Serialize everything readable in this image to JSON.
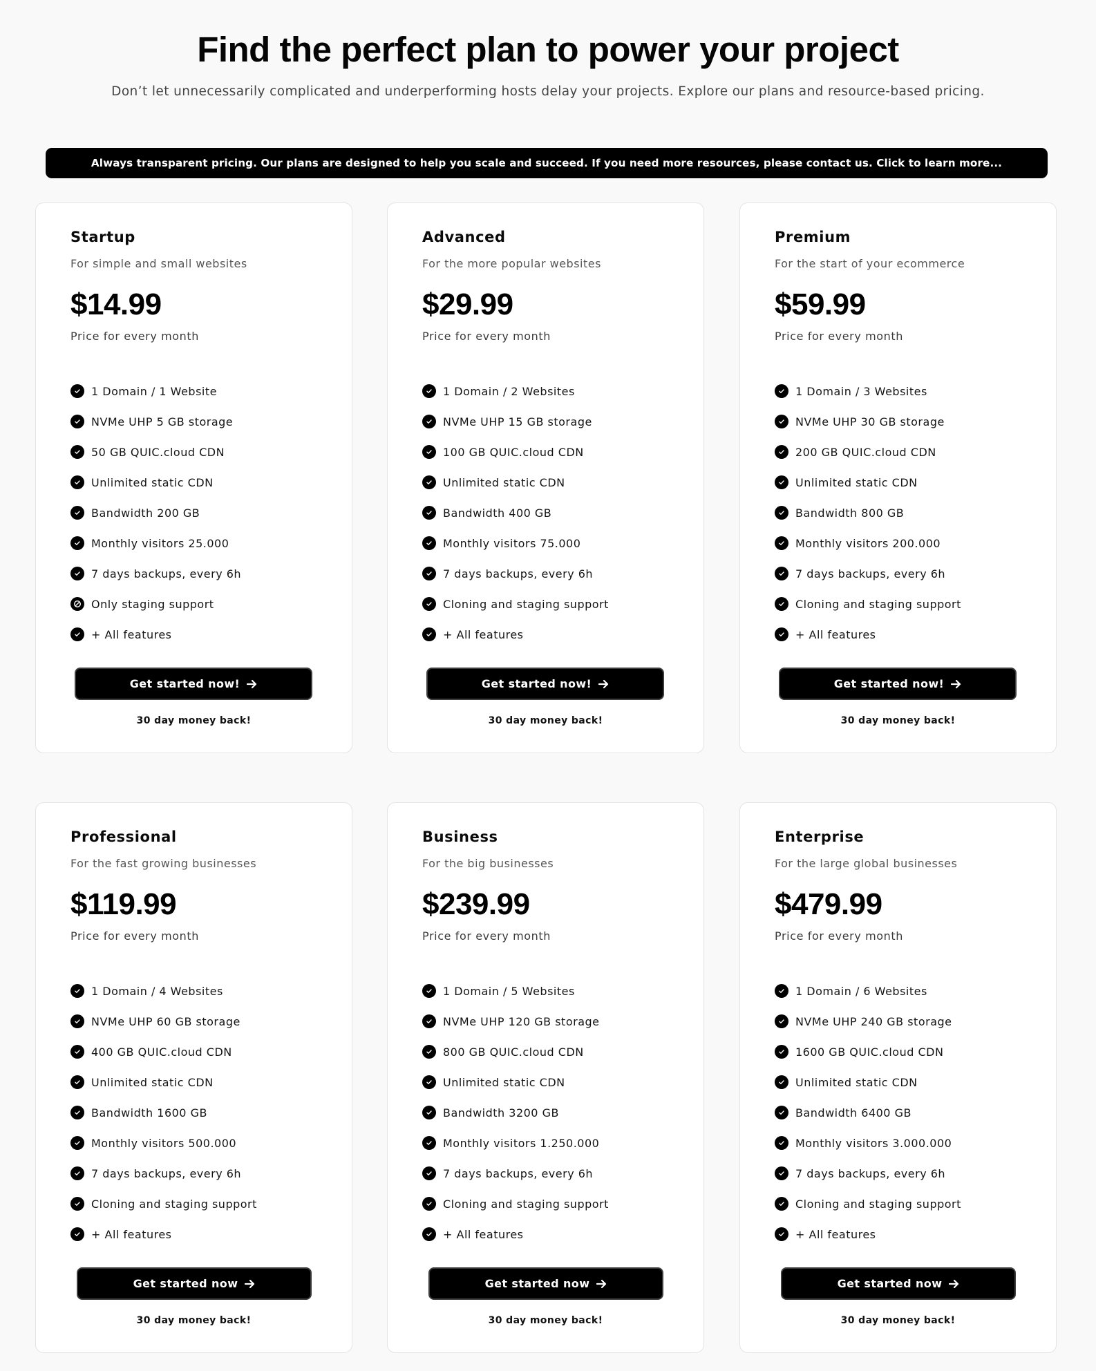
{
  "header": {
    "title": "Find the perfect plan to power your project",
    "subtitle": "Don’t let unnecessarily complicated and underperforming hosts delay your projects. Explore our plans and resource-based pricing."
  },
  "banner": {
    "text": "Always transparent pricing. Our plans are designed to help you scale and succeed. If you need more resources, please contact us. Click to learn more..."
  },
  "colors": {
    "background": "#f9f9f9",
    "card": "#ffffff",
    "accent": "#000000",
    "card_border": "#e4e4e4"
  },
  "plans": [
    {
      "name": "Startup",
      "description": "For simple and small websites",
      "price": "$14.99",
      "price_caption": "Price for every month",
      "features": [
        {
          "text": "1 Domain / 1 Website",
          "icon": "check-circle-icon"
        },
        {
          "text": "NVMe UHP 5 GB storage",
          "icon": "check-circle-icon"
        },
        {
          "text": "50 GB QUIC.cloud CDN",
          "icon": "check-circle-icon"
        },
        {
          "text": "Unlimited static CDN",
          "icon": "check-circle-icon"
        },
        {
          "text": "Bandwidth 200 GB",
          "icon": "check-circle-icon"
        },
        {
          "text": "Monthly visitors 25.000",
          "icon": "check-circle-icon"
        },
        {
          "text": "7 days backups, every 6h",
          "icon": "check-circle-icon"
        },
        {
          "text": "Only staging support",
          "icon": "ban-circle-icon"
        },
        {
          "text": "+ All features",
          "icon": "check-circle-icon"
        }
      ],
      "cta_label": "Get started now!",
      "cta_icon": "arrow-right-icon",
      "guarantee": "30 day money back!"
    },
    {
      "name": "Advanced",
      "description": "For the more popular websites",
      "price": "$29.99",
      "price_caption": "Price for every month",
      "features": [
        {
          "text": "1 Domain / 2 Websites",
          "icon": "check-circle-icon"
        },
        {
          "text": "NVMe UHP 15 GB storage",
          "icon": "check-circle-icon"
        },
        {
          "text": "100 GB QUIC.cloud CDN",
          "icon": "check-circle-icon"
        },
        {
          "text": "Unlimited static CDN",
          "icon": "check-circle-icon"
        },
        {
          "text": "Bandwidth 400 GB",
          "icon": "check-circle-icon"
        },
        {
          "text": "Monthly visitors 75.000",
          "icon": "check-circle-icon"
        },
        {
          "text": "7 days backups, every 6h",
          "icon": "check-circle-icon"
        },
        {
          "text": "Cloning and staging support",
          "icon": "check-circle-icon"
        },
        {
          "text": "+ All features",
          "icon": "check-circle-icon"
        }
      ],
      "cta_label": "Get started now!",
      "cta_icon": "arrow-right-icon",
      "guarantee": "30 day money back!"
    },
    {
      "name": "Premium",
      "description": "For the start of your ecommerce",
      "price": "$59.99",
      "price_caption": "Price for every month",
      "features": [
        {
          "text": "1 Domain / 3 Websites",
          "icon": "check-circle-icon"
        },
        {
          "text": "NVMe UHP 30 GB storage",
          "icon": "check-circle-icon"
        },
        {
          "text": "200 GB QUIC.cloud CDN",
          "icon": "check-circle-icon"
        },
        {
          "text": "Unlimited static CDN",
          "icon": "check-circle-icon"
        },
        {
          "text": "Bandwidth 800 GB",
          "icon": "check-circle-icon"
        },
        {
          "text": "Monthly visitors 200.000",
          "icon": "check-circle-icon"
        },
        {
          "text": "7 days backups, every 6h",
          "icon": "check-circle-icon"
        },
        {
          "text": "Cloning and staging support",
          "icon": "check-circle-icon"
        },
        {
          "text": "+ All features",
          "icon": "check-circle-icon"
        }
      ],
      "cta_label": "Get started now!",
      "cta_icon": "arrow-right-icon",
      "guarantee": "30 day money back!"
    },
    {
      "name": "Professional",
      "description": "For the fast growing businesses",
      "price": "$119.99",
      "price_caption": "Price for every month",
      "features": [
        {
          "text": "1 Domain / 4 Websites",
          "icon": "check-circle-icon"
        },
        {
          "text": "NVMe UHP 60 GB storage",
          "icon": "check-circle-icon"
        },
        {
          "text": "400 GB QUIC.cloud CDN",
          "icon": "check-circle-icon"
        },
        {
          "text": "Unlimited static CDN",
          "icon": "check-circle-icon"
        },
        {
          "text": "Bandwidth 1600 GB",
          "icon": "check-circle-icon"
        },
        {
          "text": "Monthly visitors 500.000",
          "icon": "check-circle-icon"
        },
        {
          "text": "7 days backups, every 6h",
          "icon": "check-circle-icon"
        },
        {
          "text": "Cloning and staging support",
          "icon": "check-circle-icon"
        },
        {
          "text": "+ All features",
          "icon": "check-circle-icon"
        }
      ],
      "cta_label": "Get started now",
      "cta_icon": "arrow-right-icon",
      "guarantee": "30 day money back!"
    },
    {
      "name": "Business",
      "description": "For the big businesses",
      "price": "$239.99",
      "price_caption": "Price for every month",
      "features": [
        {
          "text": "1 Domain / 5 Websites",
          "icon": "check-circle-icon"
        },
        {
          "text": "NVMe UHP 120 GB storage",
          "icon": "check-circle-icon"
        },
        {
          "text": "800 GB QUIC.cloud CDN",
          "icon": "check-circle-icon"
        },
        {
          "text": "Unlimited static CDN",
          "icon": "check-circle-icon"
        },
        {
          "text": "Bandwidth 3200 GB",
          "icon": "check-circle-icon"
        },
        {
          "text": "Monthly visitors 1.250.000",
          "icon": "check-circle-icon"
        },
        {
          "text": "7 days backups, every 6h",
          "icon": "check-circle-icon"
        },
        {
          "text": "Cloning and staging support",
          "icon": "check-circle-icon"
        },
        {
          "text": "+ All features",
          "icon": "check-circle-icon"
        }
      ],
      "cta_label": "Get started now",
      "cta_icon": "arrow-right-icon",
      "guarantee": "30 day money back!"
    },
    {
      "name": "Enterprise",
      "description": "For the large global businesses",
      "price": "$479.99",
      "price_caption": "Price for every month",
      "features": [
        {
          "text": "1 Domain / 6 Websites",
          "icon": "check-circle-icon"
        },
        {
          "text": "NVMe UHP 240 GB storage",
          "icon": "check-circle-icon"
        },
        {
          "text": "1600 GB QUIC.cloud CDN",
          "icon": "check-circle-icon"
        },
        {
          "text": "Unlimited static CDN",
          "icon": "check-circle-icon"
        },
        {
          "text": "Bandwidth 6400 GB",
          "icon": "check-circle-icon"
        },
        {
          "text": "Monthly visitors 3.000.000",
          "icon": "check-circle-icon"
        },
        {
          "text": "7 days backups, every 6h",
          "icon": "check-circle-icon"
        },
        {
          "text": "Cloning and staging support",
          "icon": "check-circle-icon"
        },
        {
          "text": "+ All features",
          "icon": "check-circle-icon"
        }
      ],
      "cta_label": "Get started now",
      "cta_icon": "arrow-right-icon",
      "guarantee": "30 day money back!"
    }
  ]
}
